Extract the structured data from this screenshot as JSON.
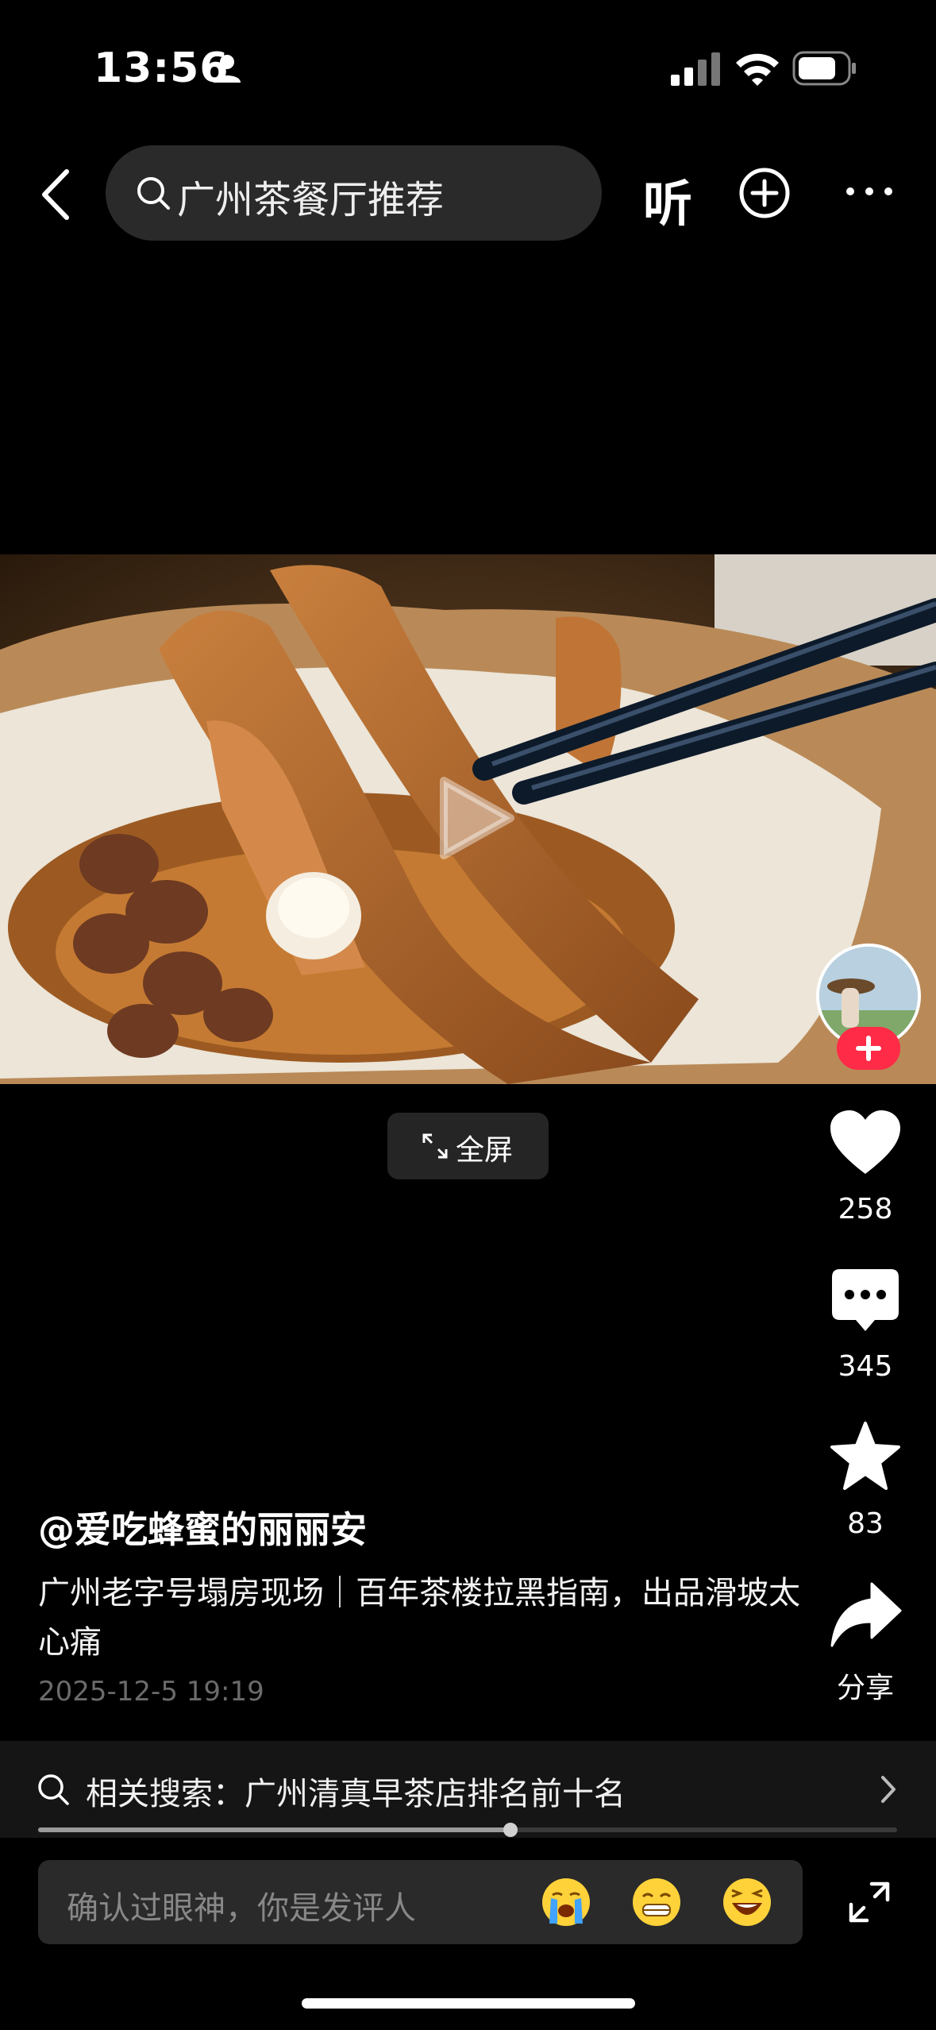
{
  "status_bar": {
    "time": "13:56",
    "icons": [
      "person-icon",
      "signal-icon",
      "wifi-icon",
      "battery-icon"
    ]
  },
  "nav": {
    "search_query": "广州茶餐厅推荐",
    "listen_label": "听",
    "icons": [
      "back-arrow-icon",
      "search-icon",
      "add-circle-icon",
      "more-icon"
    ]
  },
  "video": {
    "fullscreen_label": "全屏",
    "state": "paused"
  },
  "actions": {
    "like_count": "258",
    "comment_count": "345",
    "favorite_count": "83",
    "share_label": "分享"
  },
  "caption": {
    "author": "@爱吃蜂蜜的丽丽安",
    "description": "广州老字号塌房现场｜百年茶楼拉黑指南，出品滑坡太心痛",
    "date": "2025-12-5 19:19"
  },
  "related_search": {
    "text": "相关搜索：广州清真早茶店排名前十名"
  },
  "playback_progress": 0.55,
  "comment_bar": {
    "placeholder": "确认过眼神，你是发评人",
    "emojis": [
      "crying-emoji",
      "grinning-teeth-emoji",
      "laughing-emoji"
    ]
  },
  "colors": {
    "background": "#000000",
    "follow_badge": "#ff2b47",
    "input_bg": "#2a2a2a"
  }
}
